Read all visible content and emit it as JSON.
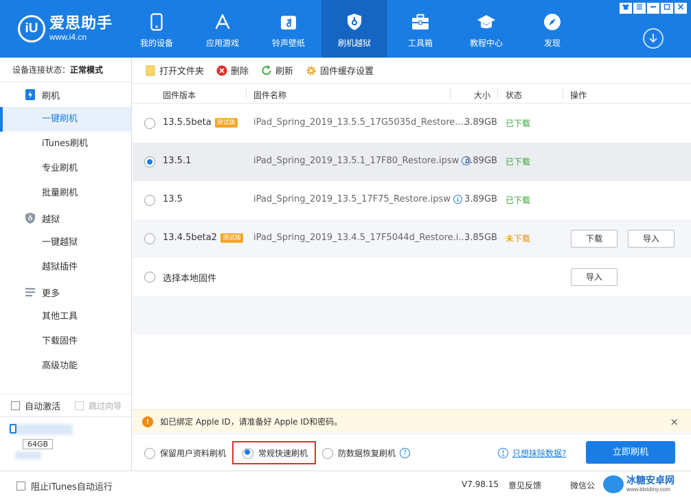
{
  "app": {
    "brand": "爱思助手",
    "url": "www.i4.cn",
    "logo_mark": "iU"
  },
  "nav": [
    {
      "label": "我的设备",
      "icon": "phone-icon"
    },
    {
      "label": "应用游戏",
      "icon": "app-store-icon"
    },
    {
      "label": "铃声壁纸",
      "icon": "music-icon"
    },
    {
      "label": "刷机越狱",
      "icon": "shield-lock-icon",
      "active": true
    },
    {
      "label": "工具箱",
      "icon": "toolbox-icon"
    },
    {
      "label": "教程中心",
      "icon": "graduation-cap-icon"
    },
    {
      "label": "发现",
      "icon": "compass-icon"
    }
  ],
  "window_controls": [
    "shirt-icon",
    "menu-icon",
    "minimize-icon",
    "maximize-icon",
    "close-icon"
  ],
  "sidebar": {
    "status_label": "设备连接状态：",
    "status_value": "正常模式",
    "groups": [
      {
        "label": "刷机",
        "icon": "flash-icon",
        "items": [
          "一键刷机",
          "iTunes刷机",
          "专业刷机",
          "批量刷机"
        ]
      },
      {
        "label": "越狱",
        "icon": "jailbreak-shield-icon",
        "items": [
          "一键越狱",
          "越狱插件"
        ]
      },
      {
        "label": "更多",
        "icon": "more-lines-icon",
        "items": [
          "其他工具",
          "下载固件",
          "高级功能"
        ]
      }
    ],
    "active_item": "一键刷机",
    "auto_activate": "自动激活",
    "skip_guide": "跳过向导",
    "storage": "64GB"
  },
  "toolbar": {
    "open_folder": "打开文件夹",
    "delete": "删除",
    "refresh": "刷新",
    "cache_settings": "固件缓存设置"
  },
  "table": {
    "headers": {
      "version": "固件版本",
      "name": "固件名称",
      "size": "大小",
      "status": "状态",
      "action": "操作"
    },
    "rows": [
      {
        "version": "13.5.5beta",
        "badge": "测试版",
        "name": "iPad_Spring_2019_13.5.5_17G5035d_Restore....",
        "size": "3.89GB",
        "status": "已下载",
        "downloaded": true,
        "selected": false
      },
      {
        "version": "13.5.1",
        "badge": "",
        "name": "iPad_Spring_2019_13.5.1_17F80_Restore.ipsw",
        "size": "3.89GB",
        "status": "已下载",
        "downloaded": true,
        "selected": true
      },
      {
        "version": "13.5",
        "badge": "",
        "name": "iPad_Spring_2019_13.5_17F75_Restore.ipsw",
        "size": "3.89GB",
        "status": "已下载",
        "downloaded": true,
        "selected": false
      },
      {
        "version": "13.4.5beta2",
        "badge": "测试版",
        "name": "iPad_Spring_2019_13.4.5_17F5044d_Restore.i...",
        "size": "3.85GB",
        "status": "未下载",
        "downloaded": false,
        "selected": false,
        "download_btn": "下载",
        "import_btn": "导入"
      }
    ],
    "local": {
      "label": "选择本地固件",
      "import_btn": "导入"
    }
  },
  "notice": {
    "text": "如已绑定 Apple ID，请准备好 Apple ID和密码。",
    "close": "×"
  },
  "flash_modes": {
    "keep_data": "保留用户资料刷机",
    "fast": "常规快速刷机",
    "anti_recovery": "防数据恢复刷机",
    "selected": "fast",
    "erase_link": "只想抹除数据?",
    "flash_button": "立即刷机"
  },
  "statusbar": {
    "itunes_block": "阻止iTunes自动运行",
    "version": "V7.98.15",
    "feedback": "意见反馈",
    "wechat": "微信公"
  },
  "watermark": {
    "name": "冰糖安卓网",
    "url": "www.btxtdmy.com"
  },
  "colors": {
    "brand_blue": "#1a7de3",
    "downloaded_green": "#3aa53a",
    "not_downloaded_orange": "#e58e0a",
    "highlight_red": "#e0302b"
  }
}
